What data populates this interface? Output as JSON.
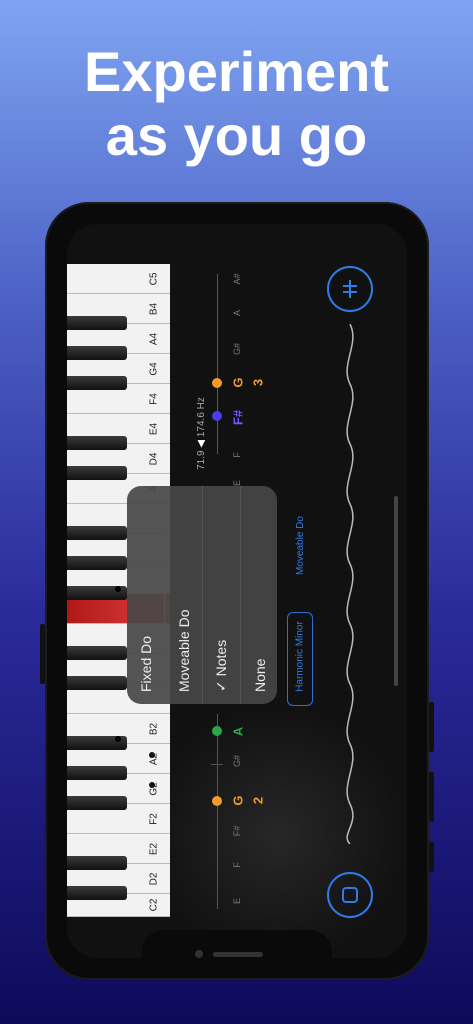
{
  "headline": {
    "line1": "Experiment",
    "line2": "as you go"
  },
  "piano": {
    "white_labels": [
      "C5",
      "B4",
      "A4",
      "G4",
      "F4",
      "E4",
      "D4",
      "4",
      "",
      "",
      "",
      "",
      "",
      "B2",
      "A2",
      "G2",
      "F2",
      "E2",
      "D2",
      "C2"
    ]
  },
  "staff": {
    "upper_notes": [
      "A#",
      "A",
      "G#"
    ],
    "upper_orange_note": "G",
    "upper_orange_num": "3",
    "upper_blue_note": "F#",
    "lower_green_note": "A",
    "lower_gsharp": "G#",
    "lower_orange_note": "G",
    "lower_orange_num": "2",
    "lower_notes": [
      "F#",
      "F",
      "E"
    ],
    "lower_misc": [
      "F",
      "E"
    ],
    "readout_left": "71.9",
    "readout_hz": "174.6 Hz",
    "colors": {
      "orange": "#f39a2b",
      "blue": "#4a3cf0",
      "green": "#2ea44a",
      "accent": "#2f7be8"
    }
  },
  "popup": {
    "options": [
      {
        "label": "Fixed Do",
        "checked": false
      },
      {
        "label": "Moveable Do",
        "checked": false
      },
      {
        "label": "Notes",
        "checked": true
      },
      {
        "label": "None",
        "checked": false
      }
    ],
    "check_mark": "✓"
  },
  "labels": {
    "moveable_do": "Moveable Do",
    "scale": "Harmonic Minor"
  },
  "icons": {
    "top_button": "tuning-fork-icon",
    "bottom_button": "stop-icon"
  }
}
